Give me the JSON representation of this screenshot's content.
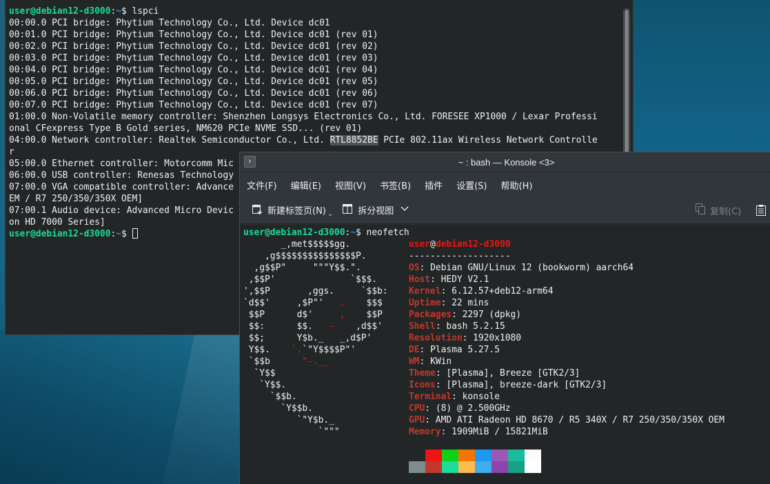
{
  "colors": {
    "terminal_bg": "#232627",
    "prompt_user": "#1cdc9a",
    "prompt_path": "#1d99f3",
    "neofetch_key": "#c0392b",
    "logo_red": "#ed1515"
  },
  "back_terminal": {
    "prompt": {
      "user_host": "user@debian12-d3000",
      "sep": ":",
      "path": "~",
      "symbol": "$ "
    },
    "command": "lspci",
    "output": [
      "00:00.0 PCI bridge: Phytium Technology Co., Ltd. Device dc01",
      "00:01.0 PCI bridge: Phytium Technology Co., Ltd. Device dc01 (rev 01)",
      "00:02.0 PCI bridge: Phytium Technology Co., Ltd. Device dc01 (rev 02)",
      "00:03.0 PCI bridge: Phytium Technology Co., Ltd. Device dc01 (rev 03)",
      "00:04.0 PCI bridge: Phytium Technology Co., Ltd. Device dc01 (rev 04)",
      "00:05.0 PCI bridge: Phytium Technology Co., Ltd. Device dc01 (rev 05)",
      "00:06.0 PCI bridge: Phytium Technology Co., Ltd. Device dc01 (rev 06)",
      "00:07.0 PCI bridge: Phytium Technology Co., Ltd. Device dc01 (rev 07)",
      "01:00.0 Non-Volatile memory controller: Shenzhen Longsys Electronics Co., Ltd. FORESEE XP1000 / Lexar Professi",
      "onal CFexpress Type B Gold series, NM620 PCIe NVME SSD... (rev 01)"
    ],
    "network_line": {
      "before": "04:00.0 Network controller: Realtek Semiconductor Co., Ltd. ",
      "highlight": "RTL8852BE",
      "after": " PCIe 802.11ax Wireless Network Controlle"
    },
    "output2": [
      "r",
      "05:00.0 Ethernet controller: Motorcomm Mic",
      "06:00.0 USB controller: Renesas Technology",
      "07:00.0 VGA compatible controller: Advance",
      "EM / R7 250/350/350X OEM]",
      "07:00.1 Audio device: Advanced Micro Devic",
      "on HD 7000 Series]"
    ]
  },
  "konsole": {
    "title": "~ : bash — Konsole <3>",
    "title_icon": "terminal-icon",
    "menu": [
      "文件(F)",
      "编辑(E)",
      "视图(V)",
      "书签(B)",
      "插件",
      "设置(S)",
      "帮助(H)"
    ],
    "toolbar": {
      "new_tab": "新建标签页(N)",
      "split_view": "拆分视图",
      "copy": "复制(C)"
    },
    "command": "neofetch",
    "logo": [
      [
        "       _,met$$$$$gg.",
        ""
      ],
      [
        "    ,g$$$$$$$$$$$$$$$P.",
        ""
      ],
      [
        "  ,g$$P\"     \"\"\"Y$$.\".",
        ""
      ],
      [
        " ,$$P'              `$$$.",
        ""
      ],
      [
        "',$$P       ,ggs.     `$$b:",
        ""
      ],
      [
        "`d$$'     ,$P\"'   .    $$$",
        ""
      ],
      [
        " $$P      d$'     ,    $$P",
        ""
      ],
      [
        " $$:      $$.   -    ,d$$'",
        ""
      ],
      [
        " $$;      Y$b._   _,d$P'",
        ""
      ],
      [
        " Y$$.    `.`\"Y$$$$P\"'",
        ""
      ],
      [
        " `$$b      \"-.__",
        ""
      ],
      [
        "  `Y$$",
        ""
      ],
      [
        "   `Y$$.",
        ""
      ],
      [
        "     `$$b.",
        ""
      ],
      [
        "       `Y$$b.",
        ""
      ],
      [
        "          `\"Y$b._",
        ""
      ],
      [
        "              `\"\"\"",
        ""
      ]
    ],
    "info_header": {
      "user": "user",
      "at": "@",
      "host": "debian12-d3000",
      "rule": "-------------------"
    },
    "info": [
      {
        "key": "OS",
        "value": "Debian GNU/Linux 12 (bookworm) aarch64"
      },
      {
        "key": "Host",
        "value": "HEDY V2.1"
      },
      {
        "key": "Kernel",
        "value": "6.12.57+deb12-arm64"
      },
      {
        "key": "Uptime",
        "value": "22 mins"
      },
      {
        "key": "Packages",
        "value": "2297 (dpkg)"
      },
      {
        "key": "Shell",
        "value": "bash 5.2.15"
      },
      {
        "key": "Resolution",
        "value": "1920x1080"
      },
      {
        "key": "DE",
        "value": "Plasma 5.27.5"
      },
      {
        "key": "WM",
        "value": "KWin"
      },
      {
        "key": "Theme",
        "value": "[Plasma], Breeze [GTK2/3]"
      },
      {
        "key": "Icons",
        "value": "[Plasma], breeze-dark [GTK2/3]"
      },
      {
        "key": "Terminal",
        "value": "konsole"
      },
      {
        "key": "CPU",
        "value": "(8) @ 2.500GHz"
      },
      {
        "key": "GPU",
        "value": "AMD ATI Radeon HD 8670 / R5 340X / R7 250/350/350X OEM"
      },
      {
        "key": "Memory",
        "value": "1909MiB / 15821MiB"
      }
    ],
    "palette_top": [
      "#232627",
      "#ed1515",
      "#11d116",
      "#f67400",
      "#1d99f3",
      "#9b59b6",
      "#1abc9c",
      "#fcfcfc"
    ],
    "palette_bottom": [
      "#7f8c8d",
      "#c0392b",
      "#1cdc9a",
      "#fdbc4b",
      "#3daee9",
      "#8e44ad",
      "#16a085",
      "#ffffff"
    ]
  }
}
